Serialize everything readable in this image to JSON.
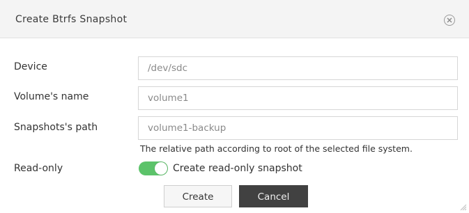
{
  "dialog": {
    "title": "Create Btrfs Snapshot",
    "close_icon": "close-circle-icon"
  },
  "form": {
    "device": {
      "label": "Device",
      "value": "/dev/sdc"
    },
    "volume_name": {
      "label": "Volume's name",
      "value": "volume1"
    },
    "snapshot_path": {
      "label": "Snapshots's path",
      "value": "volume1-backup",
      "hint": "The relative path according to root of the selected file system."
    },
    "read_only": {
      "label": "Read-only",
      "toggle_label": "Create read-only snapshot",
      "enabled": true
    }
  },
  "buttons": {
    "create_label": "Create",
    "cancel_label": "Cancel"
  },
  "colors": {
    "toggle_on": "#5cc36a",
    "cancel_bg": "#414141",
    "titlebar_bg": "#f4f4f4"
  }
}
